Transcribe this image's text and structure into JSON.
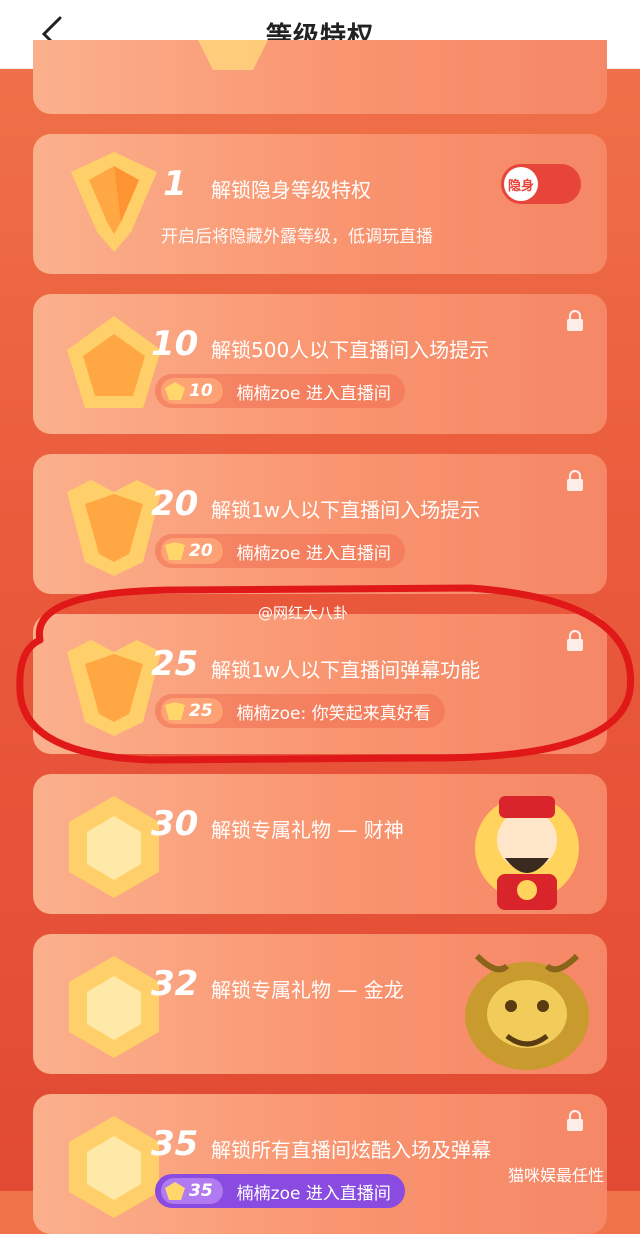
{
  "header": {
    "title": "等级特权"
  },
  "toggle": {
    "label": "隐身"
  },
  "levels": [
    {
      "level": "1",
      "title": "解锁隐身等级特权",
      "desc": "开启后将隐藏外露等级，低调玩直播"
    },
    {
      "level": "10",
      "title": "解锁500人以下直播间入场提示",
      "badge": "10",
      "message": "楠楠zoe 进入直播间"
    },
    {
      "level": "20",
      "title": "解锁1w人以下直播间入场提示",
      "badge": "20",
      "message": "楠楠zoe 进入直播间"
    },
    {
      "level": "25",
      "title": "解锁1w人以下直播间弹幕功能",
      "badge": "25",
      "message": "楠楠zoe: 你笑起来真好看"
    },
    {
      "level": "30",
      "title": "解锁专属礼物 — 财神"
    },
    {
      "level": "32",
      "title": "解锁专属礼物 — 金龙"
    },
    {
      "level": "35",
      "title": "解锁所有直播间炫酷入场及弹幕",
      "badge": "35",
      "message": "楠楠zoe 进入直播间"
    }
  ],
  "watermarks": {
    "center": "@网红大八卦",
    "bottom": "猫咪娱最任性"
  }
}
